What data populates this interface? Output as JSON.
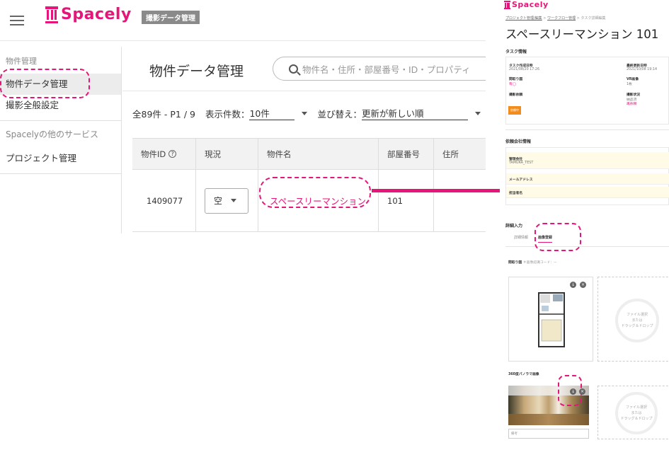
{
  "left": {
    "app_badge": "撮影データ管理",
    "logo_text": "Spacely",
    "sidebar": {
      "section_label": "物件管理",
      "items": [
        {
          "label": "物件データ管理",
          "active": true
        },
        {
          "label": "撮影全般設定",
          "active": false
        }
      ],
      "other_services_label": "Spacelyの他のサービス",
      "project_label": "プロジェクト管理"
    },
    "main": {
      "title": "物件データ管理",
      "search_placeholder": "物件名・住所・部屋番号・ID・プロパティ",
      "summary": "全89件 - P1 / 9",
      "page_size_label": "表示件数：",
      "page_size_value": "10件",
      "sort_label": "並び替え：",
      "sort_value": "更新が新しい順"
    },
    "table": {
      "headers": [
        "物件ID",
        "現況",
        "物件名",
        "部屋番号",
        "住所"
      ],
      "help_glyph": "?",
      "rows": [
        {
          "id": "1409077",
          "status": "空",
          "name": "スペースリーマンション",
          "room": "101",
          "address": ""
        }
      ]
    }
  },
  "right": {
    "logo_text": "Spacely",
    "breadcrumb": [
      "プロジェクト管理/編集",
      "ワークフロー管理",
      "タスク詳細編集"
    ],
    "breadcrumb_sep": " > ",
    "title": "スペースリーマンション 101",
    "task_section": "タスク情報",
    "task": {
      "created_label": "タスク作成日時",
      "created_value": "2021/08/20 17:26",
      "updated_label": "最終更新日時",
      "updated_value": "2021/10/08 19:14",
      "floor_label": "間取り図",
      "floor_value": "有◯",
      "vr_label": "VR画像",
      "vr_value": "1枚",
      "dept_label": "撮影依頼",
      "shoot_label": "撮影状況",
      "shoot_value1": "納品済",
      "shoot_value2": "再依頼",
      "button": "依頼中"
    },
    "info_section": "依頼会社情報",
    "info": {
      "company_label": "管理会社",
      "company_value": "TAMURA_TEST",
      "email_label": "メールアドレス",
      "name_label": "担当者名"
    },
    "detail_section": "詳細入力",
    "tabs": [
      "詳細情報",
      "画像登録"
    ],
    "floor_plan_label": "間取り図",
    "floor_plan_hint": "＃画像認識コード：ー",
    "pano_label": "360度パノラマ画像",
    "dropzone": [
      "ファイル選択",
      "または",
      "ドラッグ＆ドロップ"
    ],
    "remark_placeholder": "備考"
  },
  "colors": {
    "accent": "#e5157a",
    "orange": "#f28c1d"
  }
}
